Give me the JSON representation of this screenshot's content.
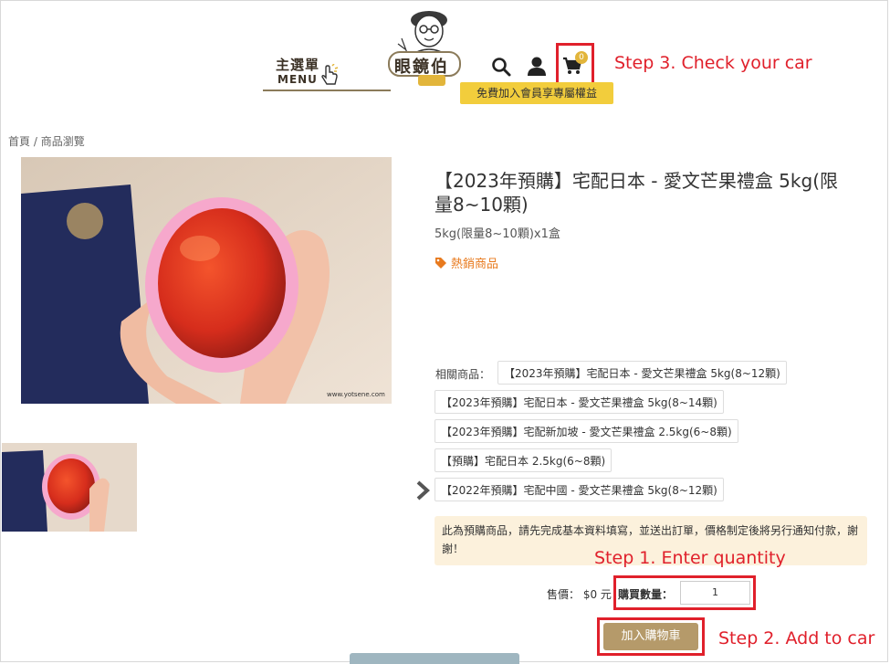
{
  "header": {
    "menu_zh": "主選單",
    "menu_en": "MENU",
    "logo_text": "眼鏡伯",
    "cart_count": "0",
    "member_banner": "免費加入會員享專屬權益"
  },
  "annotations": {
    "step3": "Step 3. Check your car",
    "step1": "Step 1. Enter quantity",
    "step2": "Step 2. Add to car"
  },
  "breadcrumb": {
    "home": "首頁",
    "separator": " / ",
    "current": "商品瀏覽"
  },
  "product": {
    "title": "【2023年預購】宅配日本 - 愛文芒果禮盒 5kg(限量8~10顆)",
    "subtitle": "5kg(限量8~10顆)x1盒",
    "hot_tag": "熱銷商品",
    "image_watermark": "www.yotsene.com"
  },
  "related": {
    "label": "相關商品：",
    "items": [
      "【2023年預購】宅配日本 - 愛文芒果禮盒 5kg(8~12顆)",
      "【2023年預購】宅配日本 - 愛文芒果禮盒 5kg(8~14顆)",
      "【2023年預購】宅配新加坡 - 愛文芒果禮盒 2.5kg(6~8顆)",
      "【預購】宅配日本 2.5kg(6~8顆)",
      "【2022年預購】宅配中國 - 愛文芒果禮盒 5kg(8~12顆)"
    ]
  },
  "notice": "此為預購商品，請先完成基本資料填寫，並送出訂單，價格制定後將另行通知付款，謝謝！",
  "purchase": {
    "price_label": "售價：",
    "price_value": "$0 元",
    "qty_label": "購買數量：",
    "qty_value": "1",
    "add_to_cart": "加入購物車"
  },
  "colors": {
    "annotation": "#e0202b",
    "accent": "#b59a6a",
    "banner": "#f2cd3c",
    "hot": "#e87a1e"
  },
  "icons": [
    "hand-pointer-icon",
    "search-icon",
    "user-icon",
    "cart-icon",
    "tag-icon",
    "chevron-right-icon"
  ]
}
